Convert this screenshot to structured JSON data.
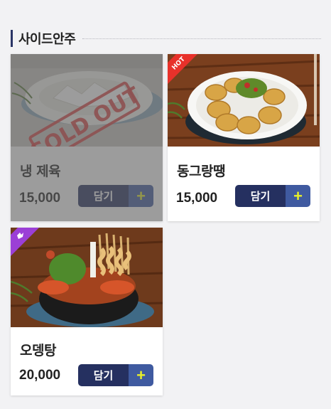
{
  "section": {
    "title": "사이드안주"
  },
  "products": [
    {
      "name": "냉 제육",
      "price": "15,000",
      "add_label": "담기",
      "plus": "+",
      "badge": "",
      "sold_out_label": "SOLD OUT",
      "image": "food-photo-jeyuk"
    },
    {
      "name": "동그랑땡",
      "price": "15,000",
      "add_label": "담기",
      "plus": "+",
      "badge": "HOT",
      "image": "food-photo-donggeurangttaeng"
    },
    {
      "name": "오뎅탕",
      "price": "20,000",
      "add_label": "담기",
      "plus": "+",
      "badge": "",
      "image": "food-photo-odengtang"
    }
  ],
  "colors": {
    "button_dark": "#253060",
    "button_plus": "#3f5aa0",
    "plus_glyph": "#e8f02a",
    "hot_badge": "#e8312a",
    "new_badge": "#9b3fd6"
  }
}
